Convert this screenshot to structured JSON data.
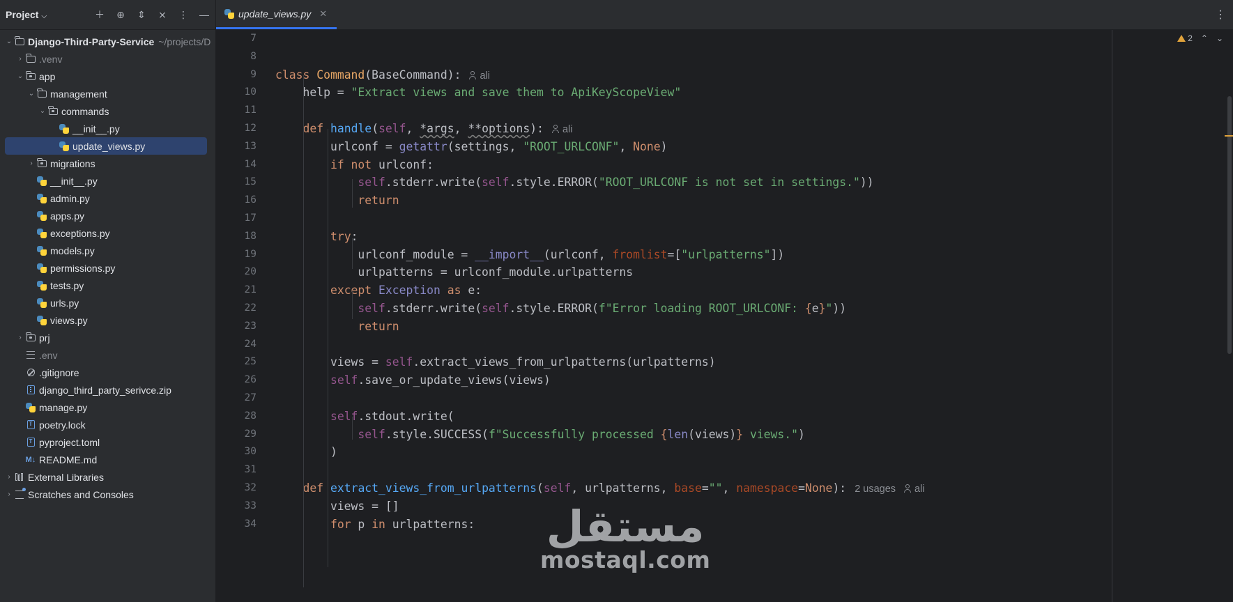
{
  "sidebar": {
    "title": "Project",
    "tree": [
      {
        "label": "Django-Third-Party-Service",
        "path": "~/projects/D",
        "bold": true,
        "indent": 0,
        "arrow": "open",
        "icon": "folder"
      },
      {
        "label": ".venv",
        "indent": 1,
        "arrow": "closed",
        "icon": "folder",
        "muted": true
      },
      {
        "label": "app",
        "indent": 1,
        "arrow": "open",
        "icon": "package"
      },
      {
        "label": "management",
        "indent": 2,
        "arrow": "open",
        "icon": "folder"
      },
      {
        "label": "commands",
        "indent": 3,
        "arrow": "open",
        "icon": "package"
      },
      {
        "label": "__init__.py",
        "indent": 4,
        "icon": "python"
      },
      {
        "label": "update_views.py",
        "indent": 4,
        "icon": "python",
        "selected": true
      },
      {
        "label": "migrations",
        "indent": 2,
        "arrow": "closed",
        "icon": "package"
      },
      {
        "label": "__init__.py",
        "indent": 2,
        "icon": "python"
      },
      {
        "label": "admin.py",
        "indent": 2,
        "icon": "python"
      },
      {
        "label": "apps.py",
        "indent": 2,
        "icon": "python"
      },
      {
        "label": "exceptions.py",
        "indent": 2,
        "icon": "python"
      },
      {
        "label": "models.py",
        "indent": 2,
        "icon": "python"
      },
      {
        "label": "permissions.py",
        "indent": 2,
        "icon": "python"
      },
      {
        "label": "tests.py",
        "indent": 2,
        "icon": "python"
      },
      {
        "label": "urls.py",
        "indent": 2,
        "icon": "python"
      },
      {
        "label": "views.py",
        "indent": 2,
        "icon": "python"
      },
      {
        "label": "prj",
        "indent": 1,
        "arrow": "closed",
        "icon": "package"
      },
      {
        "label": ".env",
        "indent": 1,
        "icon": "lines",
        "muted": true
      },
      {
        "label": ".gitignore",
        "indent": 1,
        "icon": "ban"
      },
      {
        "label": "django_third_party_serivce.zip",
        "indent": 1,
        "icon": "zip"
      },
      {
        "label": "manage.py",
        "indent": 1,
        "icon": "python"
      },
      {
        "label": "poetry.lock",
        "indent": 1,
        "icon": "text"
      },
      {
        "label": "pyproject.toml",
        "indent": 1,
        "icon": "text"
      },
      {
        "label": "README.md",
        "indent": 1,
        "icon": "markdown"
      },
      {
        "label": "External Libraries",
        "indent": 0,
        "arrow": "closed",
        "icon": "library"
      },
      {
        "label": "Scratches and Consoles",
        "indent": 0,
        "arrow": "closed",
        "icon": "scratch"
      }
    ]
  },
  "editor": {
    "tab_label": "update_views.py",
    "inspection_count": "2",
    "lines": [
      {
        "n": "7",
        "html": ""
      },
      {
        "n": "8",
        "html": ""
      },
      {
        "n": "9",
        "html": "<span class='k'>class</span> <span class='c'>Command</span>(BaseCommand):",
        "hint": "ali"
      },
      {
        "n": "10",
        "html": "    help = <span class='s'>\"Extract views and save them to ApiKeyScopeView\"</span>"
      },
      {
        "n": "11",
        "html": ""
      },
      {
        "n": "12",
        "html": "    <span class='k'>def</span> <span class='f'>handle</span>(<span class='self'>self</span>, <span class='warnu'>*args</span>, <span class='warnu'>**options</span>):",
        "hint": "ali"
      },
      {
        "n": "13",
        "html": "        urlconf = <span class='blt'>getattr</span>(settings, <span class='s'>\"ROOT_URLCONF\"</span>, <span class='k'>None</span>)"
      },
      {
        "n": "14",
        "html": "        <span class='k'>if not</span> urlconf:"
      },
      {
        "n": "15",
        "html": "            <span class='self'>self</span>.stderr.write(<span class='self'>self</span>.style.ERROR(<span class='s'>\"ROOT_URLCONF is not set in settings.\"</span>))"
      },
      {
        "n": "16",
        "html": "            <span class='k'>return</span>"
      },
      {
        "n": "17",
        "html": ""
      },
      {
        "n": "18",
        "html": "        <span class='k'>try</span>:"
      },
      {
        "n": "19",
        "html": "            urlconf_module = <span class='blt'>__import__</span>(urlconf, <span class='kw'>fromlist</span>=[<span class='s'>\"urlpatterns\"</span>])"
      },
      {
        "n": "20",
        "html": "            urlpatterns = urlconf_module.urlpatterns"
      },
      {
        "n": "21",
        "html": "        <span class='k'>except</span> <span class='blt'>Exception</span> <span class='k'>as</span> e:"
      },
      {
        "n": "22",
        "html": "            <span class='self'>self</span>.stderr.write(<span class='self'>self</span>.style.ERROR(<span class='s'>f\"Error loading ROOT_URLCONF: </span><span class='fmt'>{</span>e<span class='fmt'>}</span><span class='s'>\"</span>))"
      },
      {
        "n": "23",
        "html": "            <span class='k'>return</span>"
      },
      {
        "n": "24",
        "html": ""
      },
      {
        "n": "25",
        "html": "        views = <span class='self'>self</span>.extract_views_from_urlpatterns(urlpatterns)"
      },
      {
        "n": "26",
        "html": "        <span class='self'>self</span>.save_or_update_views(views)"
      },
      {
        "n": "27",
        "html": ""
      },
      {
        "n": "28",
        "html": "        <span class='self'>self</span>.stdout.write("
      },
      {
        "n": "29",
        "html": "            <span class='self'>self</span>.style.SUCCESS(<span class='s'>f\"Successfully processed </span><span class='fmt'>{</span><span class='blt'>len</span>(views)<span class='fmt'>}</span><span class='s'> views.\"</span>)"
      },
      {
        "n": "30",
        "html": "        )"
      },
      {
        "n": "31",
        "html": ""
      },
      {
        "n": "32",
        "html": "    <span class='k'>def</span> <span class='f'>extract_views_from_urlpatterns</span>(<span class='self'>self</span>, urlpatterns, <span class='kw'>base</span>=<span class='s'>\"\"</span>, <span class='kw'>namespace</span>=<span class='k'>None</span>):",
        "usages": "2 usages",
        "hint": "ali"
      },
      {
        "n": "33",
        "html": "        views = []"
      },
      {
        "n": "34",
        "html": "        <span class='k'>for</span> p <span class='k'>in</span> urlpatterns:"
      }
    ]
  },
  "watermark": {
    "arabic": "مستقل",
    "latin": "mostaql.com"
  }
}
